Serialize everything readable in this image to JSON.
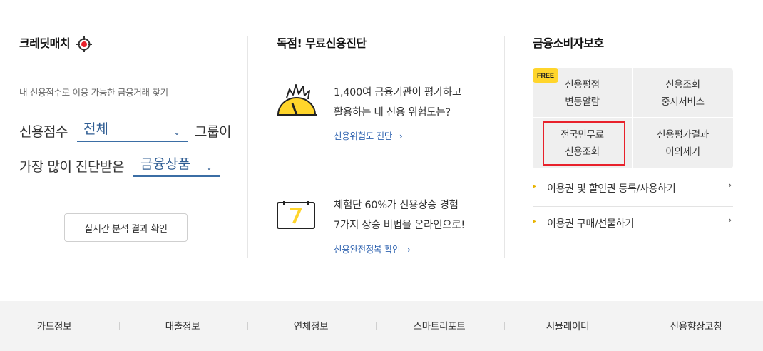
{
  "credit_match": {
    "title": "크레딧매치",
    "description": "내 신용점수로 이용 가능한 금융거래 찾기",
    "line1_prefix": "신용점수",
    "score_select": "전체",
    "line1_suffix": "그룹이",
    "line2_prefix": "가장 많이 진단받은",
    "product_select": "금융상품",
    "result_button": "실시간 분석 결과 확인"
  },
  "diagnosis": {
    "title": "독점! 무료신용진단",
    "items": [
      {
        "line1": "1,400여 금융기관이 평가하고",
        "line2": "활용하는 내 신용 위험도는?",
        "link": "신용위험도 진단",
        "icon": "gauge-icon"
      },
      {
        "line1": "체험단 60%가 신용상승 경험",
        "line2": "7가지 상승 비법을 온라인으로!",
        "link": "신용완전정복 확인",
        "icon": "calendar-7-icon"
      }
    ]
  },
  "protection": {
    "title": "금융소비자보호",
    "free_badge": "FREE",
    "cells": [
      {
        "line1": "신용평점",
        "line2": "변동알람"
      },
      {
        "line1": "신용조회",
        "line2": "중지서비스"
      },
      {
        "line1": "전국민무료",
        "line2": "신용조회"
      },
      {
        "line1": "신용평가결과",
        "line2": "이의제기"
      }
    ],
    "coupons": [
      "이용권 및 할인권 등록/사용하기",
      "이용권 구매/선물하기"
    ]
  },
  "footer": {
    "items": [
      "카드정보",
      "대출정보",
      "연체정보",
      "스마트리포트",
      "시뮬레이터",
      "신용향상코칭"
    ]
  },
  "colors": {
    "accent_blue": "#2f63b0",
    "highlight_red": "#e8212b",
    "badge_yellow": "#ffd52b"
  }
}
